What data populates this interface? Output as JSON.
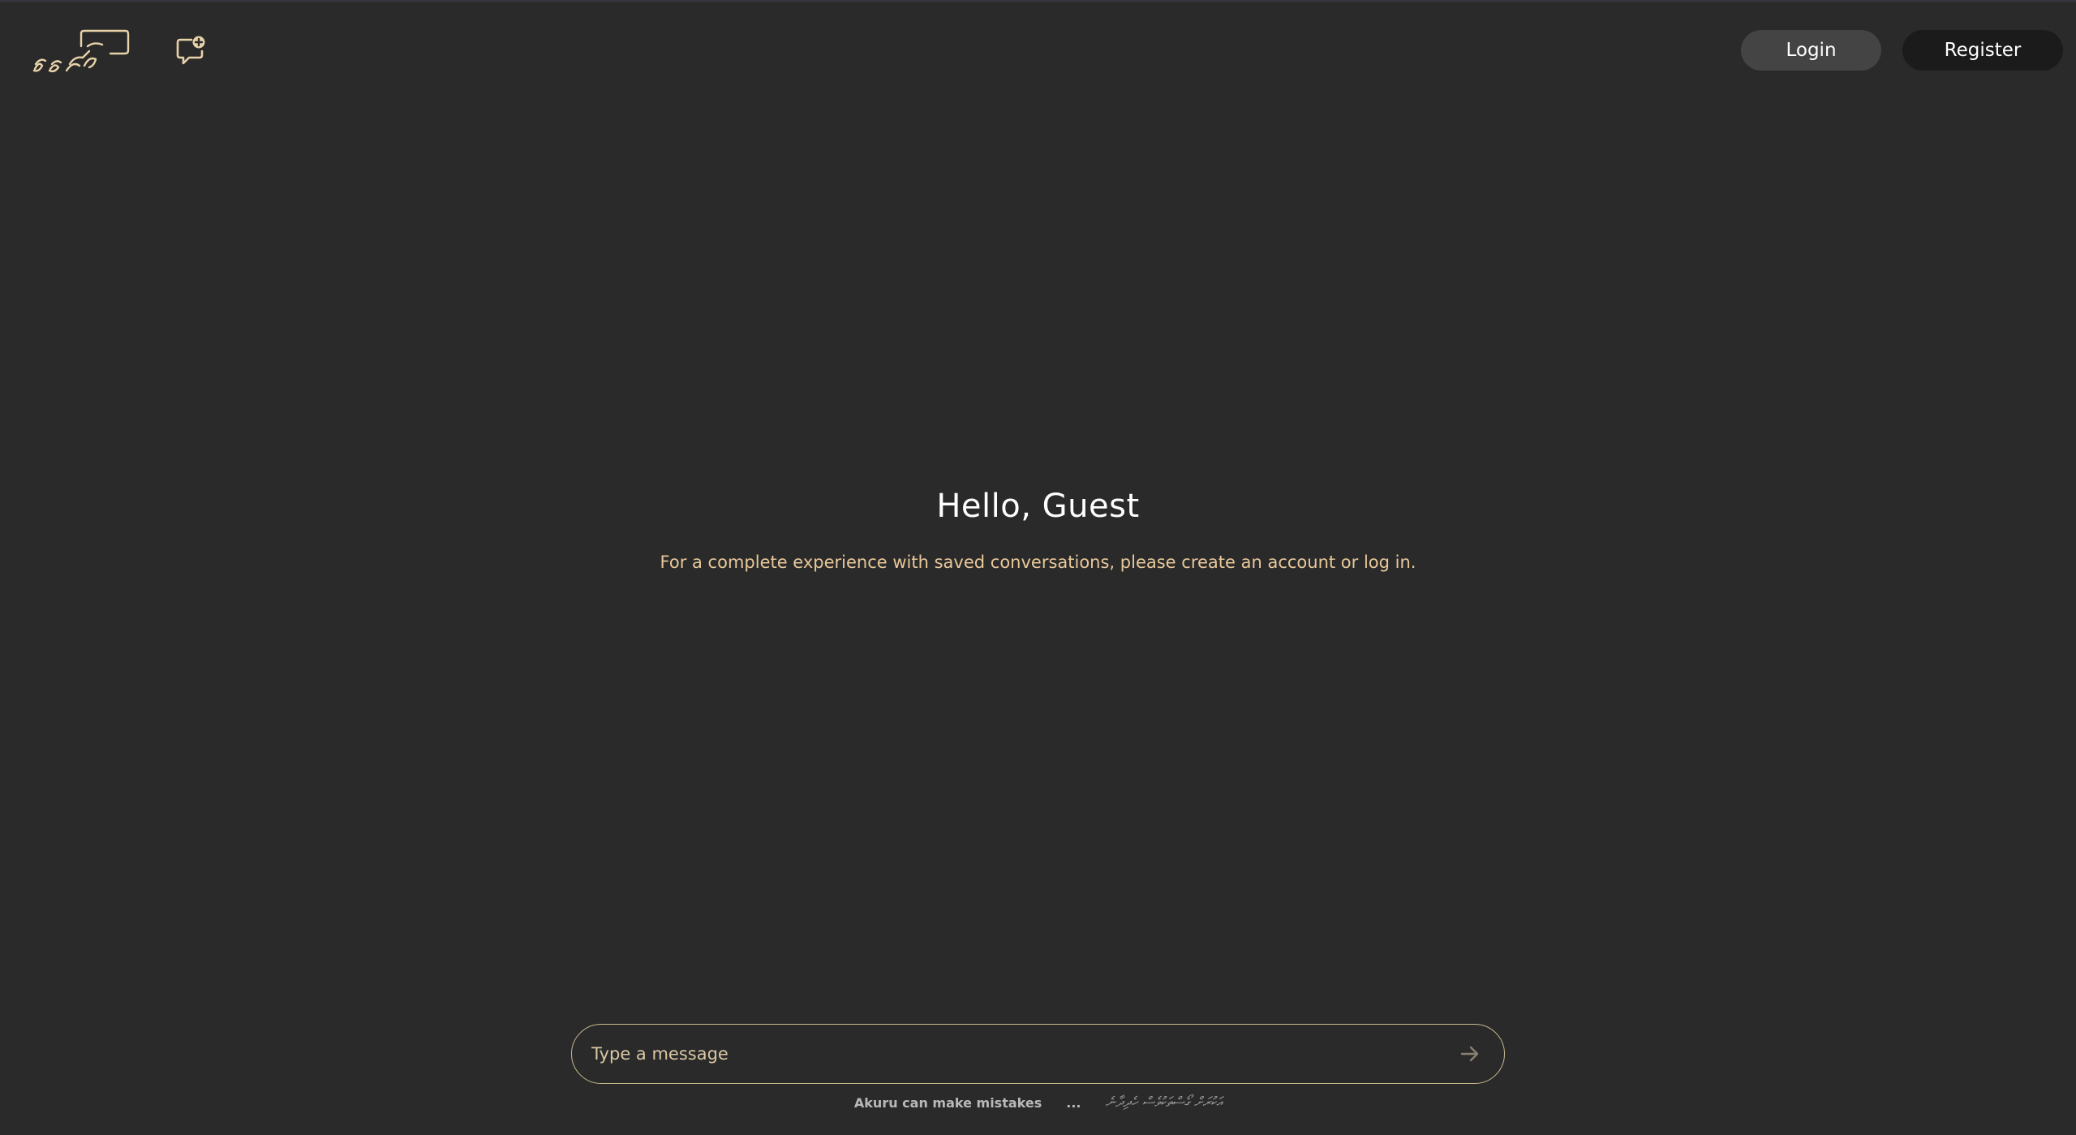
{
  "header": {
    "logo_text": "އަކުރު",
    "login_label": "Login",
    "register_label": "Register"
  },
  "hero": {
    "title": "Hello, Guest",
    "subtitle": "For a complete experience with saved conversations, please create an account or log in."
  },
  "composer": {
    "placeholder": "Type a message"
  },
  "footer": {
    "disclaimer_en": "Akuru can make mistakes",
    "separator": "...",
    "disclaimer_dv": "އަކުރަށް ގޯސްތަކުވެސް ހެދިދާނެ"
  },
  "colors": {
    "background": "#2a2a2a",
    "accent": "#e8c89a",
    "border": "#c7b98e",
    "login_bg": "#444444",
    "register_bg": "#1b1b1b"
  },
  "icons": {
    "logo": "akuru-logo-icon",
    "new_chat": "new-chat-icon",
    "send": "arrow-right-icon"
  }
}
